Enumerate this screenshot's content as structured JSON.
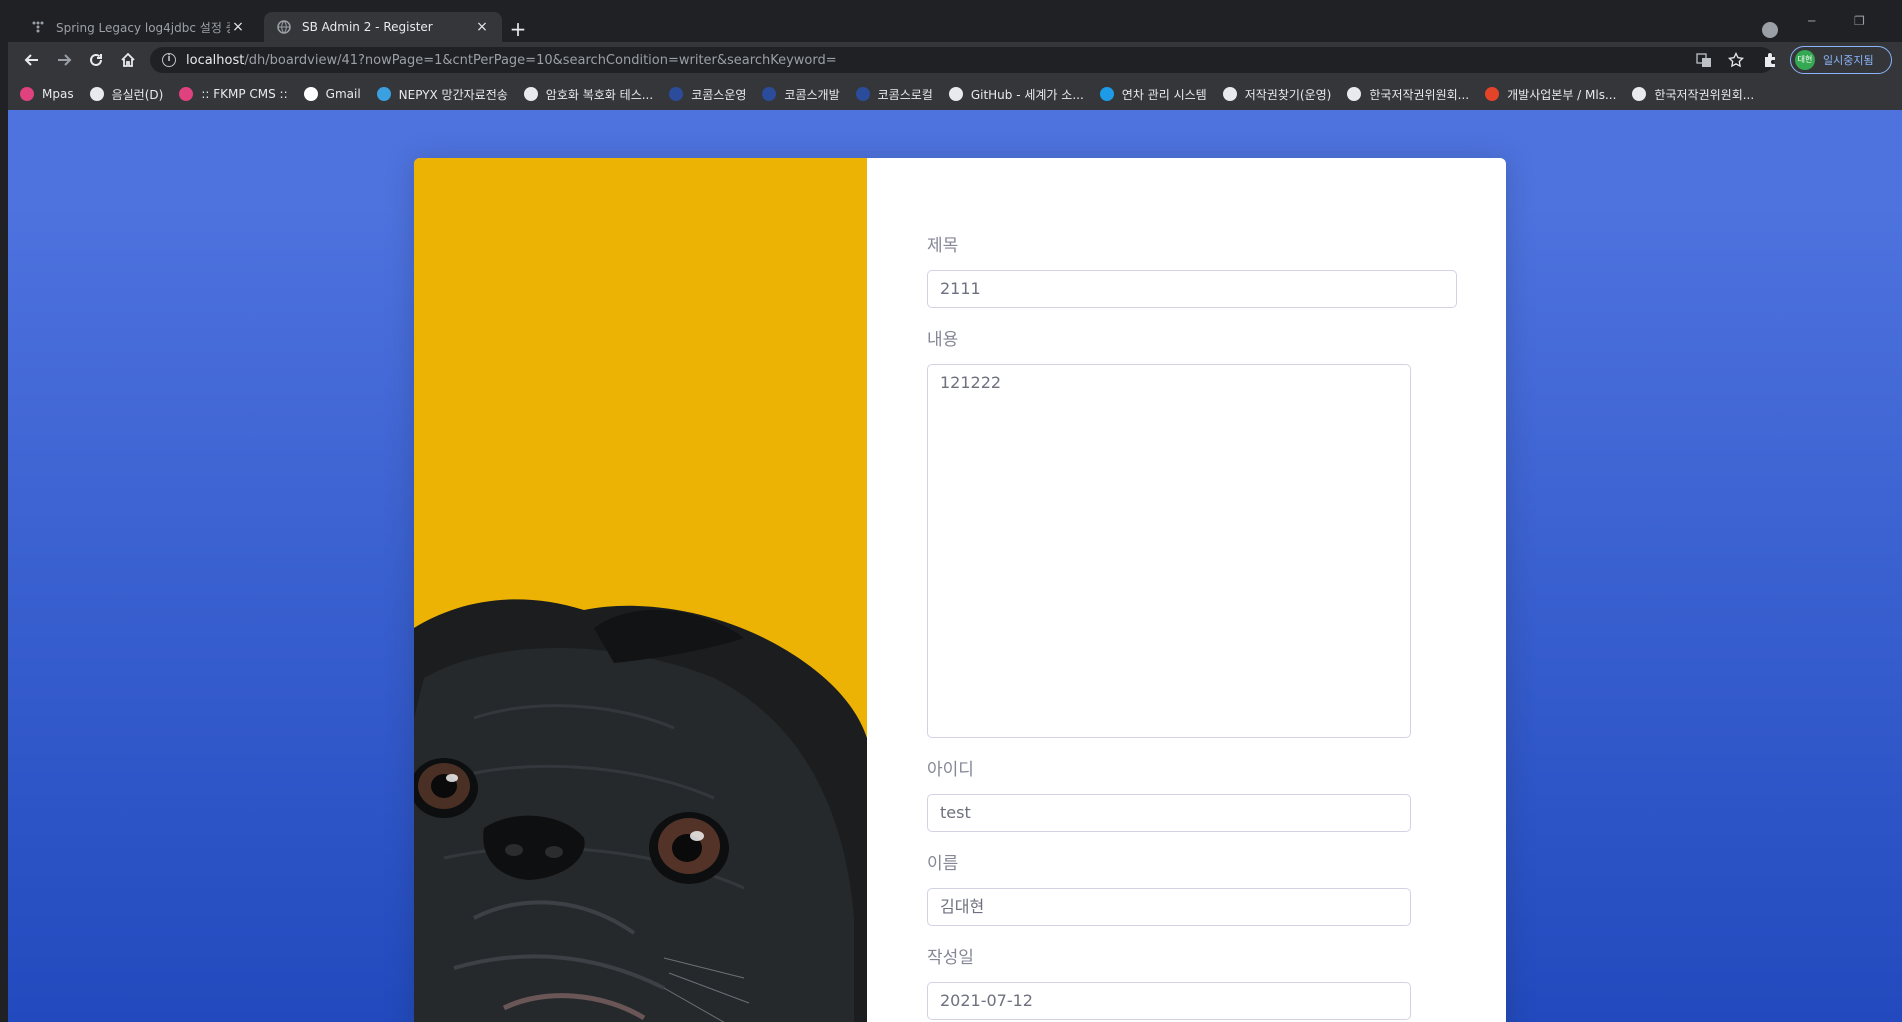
{
  "browser": {
    "tabs": [
      {
        "title": "Spring Legacy log4jdbc 설정 중",
        "active": false
      },
      {
        "title": "SB Admin 2 - Register",
        "active": true
      }
    ],
    "new_tab_label": "+",
    "close_glyph": "×",
    "url_host": "localhost",
    "url_path": "/dh/boardview/41?nowPage=1&cntPerPage=10&searchCondition=writer&searchKeyword=",
    "profile_initial": "대현",
    "profile_label": "일시중지됨",
    "window_controls": [
      "─",
      "❐"
    ],
    "bookmarks": [
      {
        "label": "Mpas",
        "icon": "k-icon",
        "color": "#e0417f"
      },
      {
        "label": "음실런(D)",
        "icon": "globe-icon",
        "color": "#e8eaed"
      },
      {
        "label": ":: FKMP CMS ::",
        "icon": "k-icon",
        "color": "#e0417f"
      },
      {
        "label": "Gmail",
        "icon": "google-icon",
        "color": "#ffffff"
      },
      {
        "label": "NEPYX 망간자료전송",
        "icon": "nepyx-icon",
        "color": "#3aa0e0"
      },
      {
        "label": "암호화 복호화 테스...",
        "icon": "globe-icon",
        "color": "#e8eaed"
      },
      {
        "label": "코콤스운영",
        "icon": "kocoms-icon",
        "color": "#2b4c9a"
      },
      {
        "label": "코콤스개발",
        "icon": "kocoms-icon",
        "color": "#2b4c9a"
      },
      {
        "label": "코콤스로컬",
        "icon": "kocoms-icon",
        "color": "#2b4c9a"
      },
      {
        "label": "GitHub - 세계가 소...",
        "icon": "github-icon",
        "color": "#e8eaed"
      },
      {
        "label": "연차 관리 시스템",
        "icon": "d-icon",
        "color": "#1e9be6"
      },
      {
        "label": "저작권찾기(운영)",
        "icon": "globe-icon",
        "color": "#e8eaed"
      },
      {
        "label": "한국저작권위원회...",
        "icon": "globe-icon",
        "color": "#e8eaed"
      },
      {
        "label": "개발사업본부 / Mls...",
        "icon": "gitlab-icon",
        "color": "#e24329"
      },
      {
        "label": "한국저작권위원회...",
        "icon": "globe-icon",
        "color": "#e8eaed"
      }
    ]
  },
  "form": {
    "title": {
      "label": "제목",
      "value": "2111"
    },
    "content": {
      "label": "내용",
      "value": "121222"
    },
    "user_id": {
      "label": "아이디",
      "value": "test"
    },
    "name": {
      "label": "이름",
      "value": "김대현"
    },
    "date": {
      "label": "작성일",
      "value": "2021-07-12"
    }
  },
  "colors": {
    "page_gradient_top": "#4e73df",
    "page_gradient_bottom": "#224abe",
    "image_panel": "#ecb304"
  }
}
